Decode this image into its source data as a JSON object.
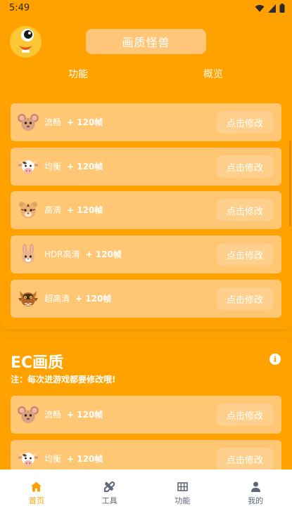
{
  "status_bar": {
    "time": "5:49"
  },
  "header": {
    "app_title": "画质怪兽"
  },
  "tabs": [
    {
      "label": "功能"
    },
    {
      "label": "概览"
    }
  ],
  "modes": [
    {
      "name": "流畅",
      "fps": "+ 120帧",
      "button": "点击修改",
      "icon": "mouse-face-icon"
    },
    {
      "name": "均衡",
      "fps": "+ 120帧",
      "button": "点击修改",
      "icon": "cow-face-icon"
    },
    {
      "name": "高清",
      "fps": "+ 120帧",
      "button": "点击修改",
      "icon": "tiger-face-icon"
    },
    {
      "name": "HDR高清",
      "fps": "+ 120帧",
      "button": "点击修改",
      "icon": "rabbit-face-icon"
    },
    {
      "name": "超高清",
      "fps": "+ 120帧",
      "button": "点击修改",
      "icon": "dragon-face-icon"
    }
  ],
  "ec_section": {
    "title": "EC画质",
    "note": "注：每次进游戏都要修改哦!",
    "info_icon": "i",
    "modes": [
      {
        "name": "流畅",
        "fps": "+ 120帧",
        "button": "点击修改",
        "icon": "mouse-face-icon"
      },
      {
        "name": "均衡",
        "fps": "+ 120帧",
        "button": "点击修改",
        "icon": "cow-face-icon"
      }
    ]
  },
  "bottom_nav": [
    {
      "label": "首页",
      "icon": "home-icon",
      "active": true
    },
    {
      "label": "工具",
      "icon": "tools-icon",
      "active": false
    },
    {
      "label": "功能",
      "icon": "grid-icon",
      "active": false
    },
    {
      "label": "我的",
      "icon": "person-icon",
      "active": false
    }
  ],
  "colors": {
    "accent": "#ffa200",
    "card": "#ffc774",
    "button": "#ffd08d",
    "nav_inactive": "#5d6778"
  }
}
